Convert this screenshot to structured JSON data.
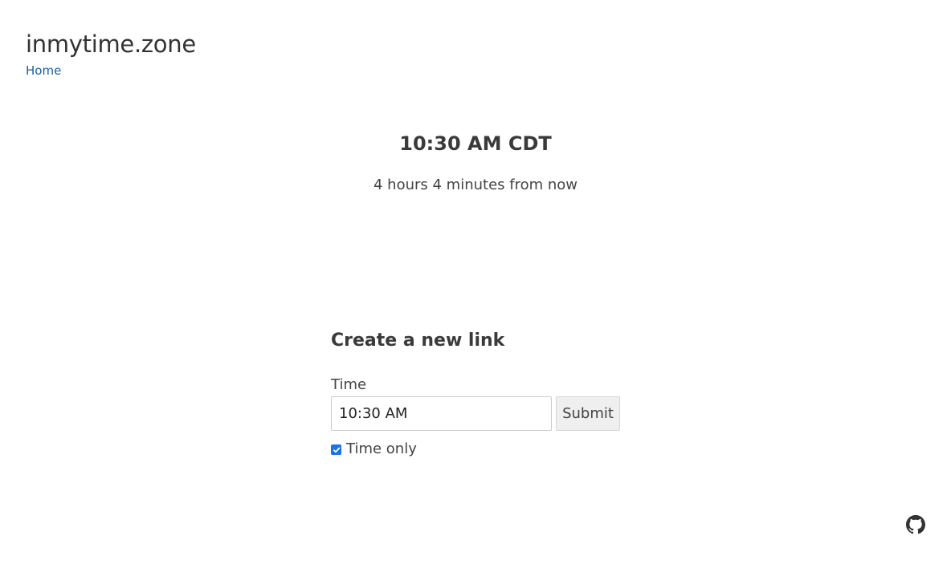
{
  "header": {
    "site_title": "inmytime.zone",
    "nav_home_label": "Home"
  },
  "main": {
    "time_display": "10:30 AM CDT",
    "relative_time": "4 hours 4 minutes from now"
  },
  "form": {
    "heading": "Create a new link",
    "time_label": "Time",
    "time_value": "10:30 AM",
    "submit_label": "Submit",
    "time_only_label": "Time only",
    "time_only_checked": true
  },
  "footer": {
    "github_icon": "github-icon"
  },
  "colors": {
    "link": "#1a5fa8",
    "checkbox_accent": "#1a73e8",
    "text": "#333333"
  }
}
